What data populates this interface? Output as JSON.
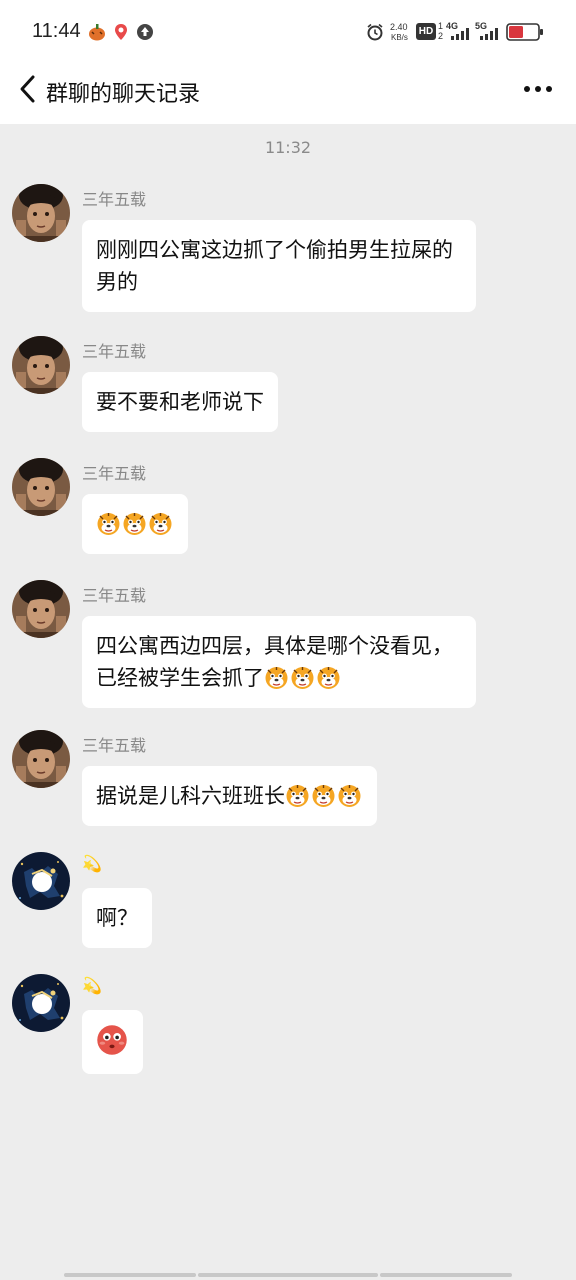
{
  "status_bar": {
    "time": "11:44",
    "net_speed": "2.40",
    "net_unit": "KB/s",
    "hd_label": "HD",
    "hd_sub_top": "1",
    "hd_sub_bottom": "2",
    "signal1_label": "4G",
    "signal2_label": "5G",
    "battery_color": "#d9363e"
  },
  "header": {
    "title": "群聊的聊天记录",
    "back_icon": "chevron-left-icon",
    "more_icon": "more-horizontal-icon"
  },
  "chat": {
    "timestamp": "11:32",
    "messages": [
      {
        "sender": "三年五载",
        "text": "刚刚四公寓这边抓了个偷拍男生拉屎的男的",
        "emoji_count": 0
      },
      {
        "sender": "三年五载",
        "text": "要不要和老师说下",
        "emoji_count": 0
      },
      {
        "sender": "三年五载",
        "text": "",
        "emoji": "tiger-face-emoji",
        "emoji_count": 3
      },
      {
        "sender": "三年五载",
        "text": "四公寓西边四层，具体是哪个没看见，已经被学生会抓了",
        "emoji": "tiger-face-emoji",
        "emoji_count": 3
      },
      {
        "sender": "三年五载",
        "text": "据说是儿科六班班长",
        "emoji": "tiger-face-emoji",
        "emoji_count": 3
      },
      {
        "sender": "💫",
        "text": "啊？",
        "emoji_count": 0
      },
      {
        "sender": "💫",
        "text": "",
        "emoji": "flushed-face-emoji",
        "emoji_count": 1
      }
    ]
  },
  "colors": {
    "background": "#ededed",
    "bubble": "#ffffff",
    "meta_text": "#888888"
  }
}
